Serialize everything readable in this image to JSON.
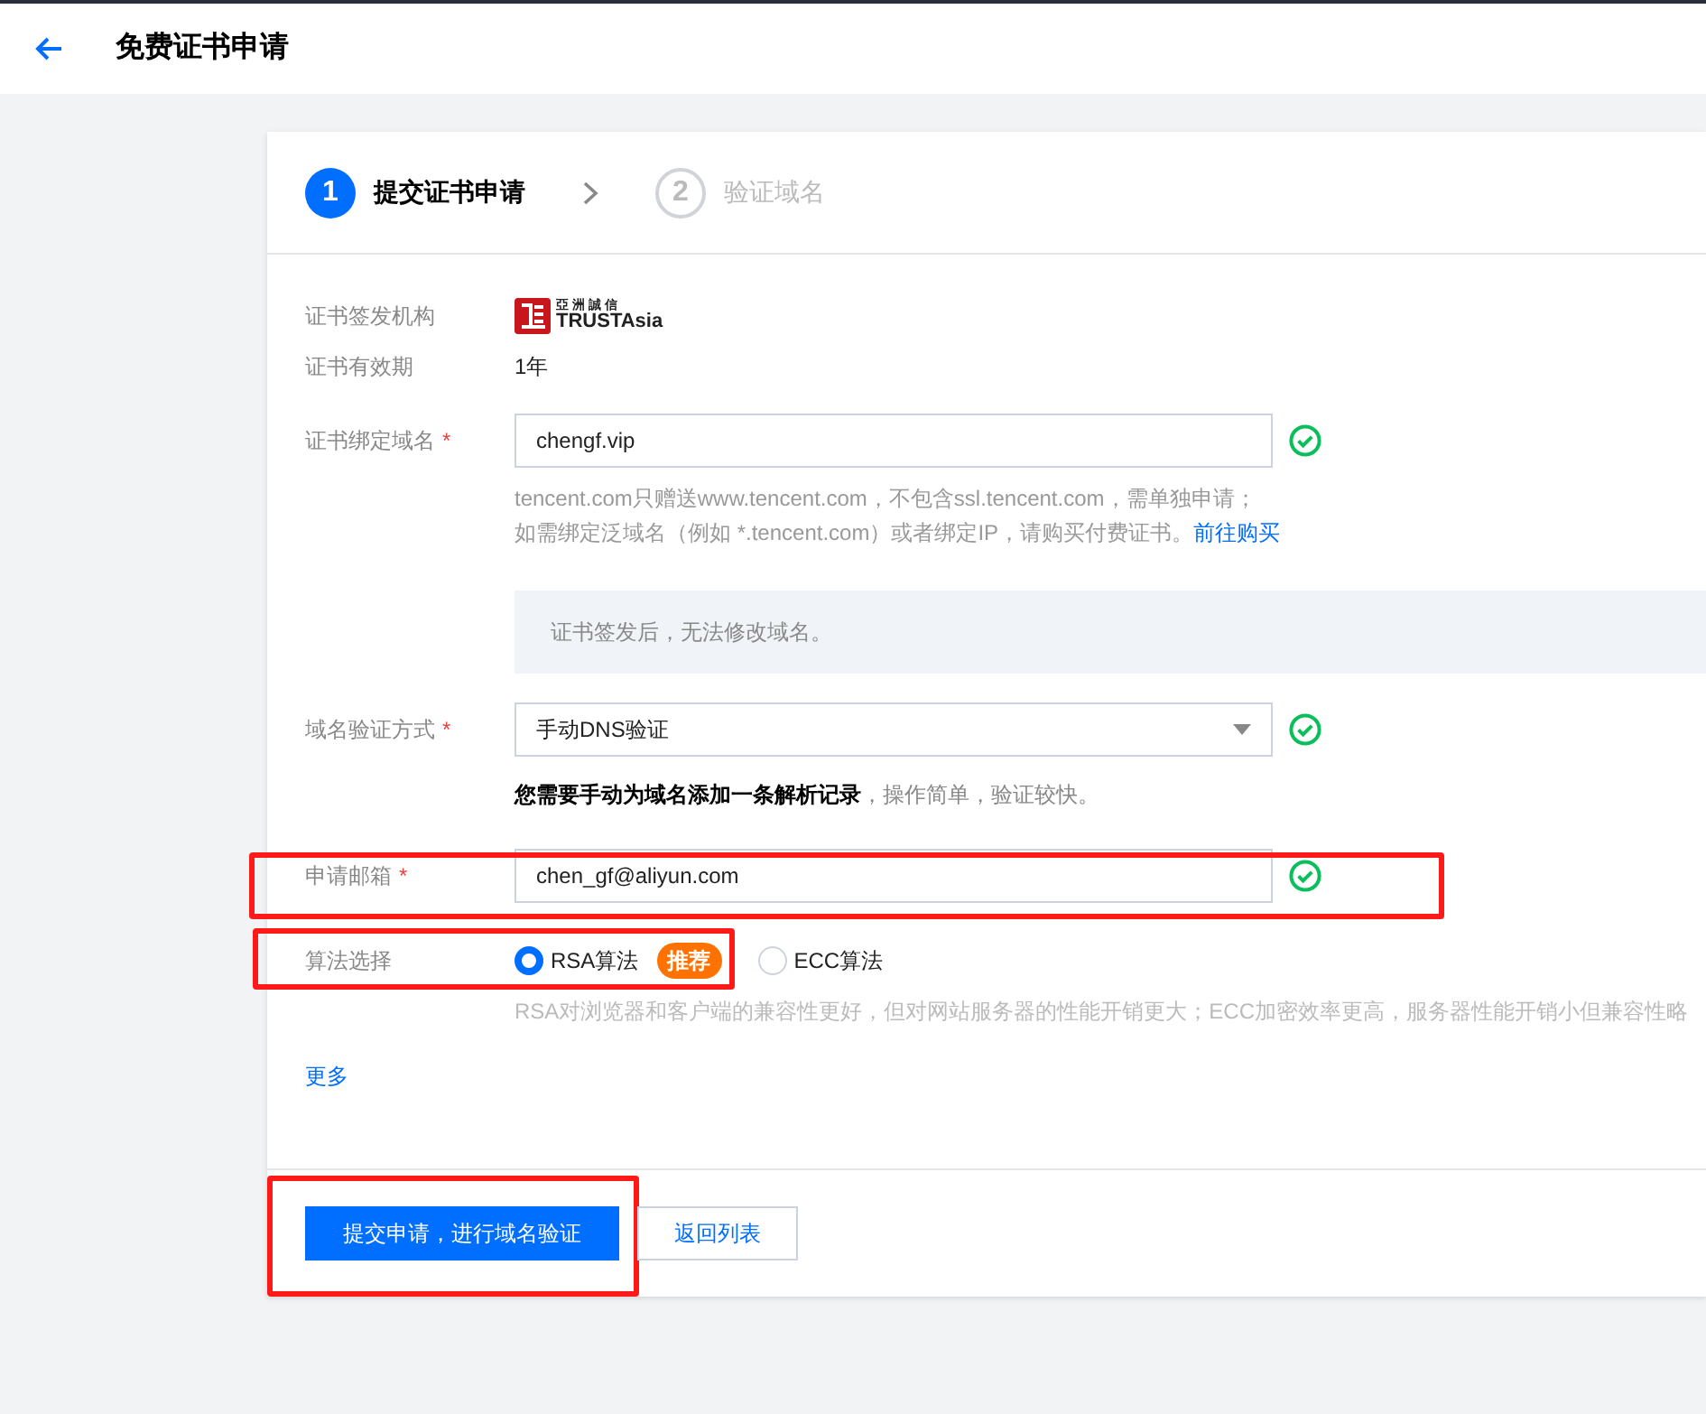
{
  "header": {
    "title": "免费证书申请"
  },
  "steps": [
    {
      "number": "1",
      "label": "提交证书申请",
      "selected": true
    },
    {
      "number": "2",
      "label": "验证域名",
      "selected": false
    }
  ],
  "form": {
    "rows": [
      {
        "kind": "logo",
        "label": "证书签发机构",
        "logo": {
          "name_cn": "亞洲誠信",
          "name_en": "TRUSTAsia"
        }
      },
      {
        "kind": "text",
        "label": "证书有效期",
        "value": "1年"
      },
      {
        "kind": "input",
        "label": "证书绑定域名",
        "required_mark": "*",
        "value": "chengf.vip",
        "valid": true,
        "highlighted": false,
        "hint_lines": [
          "tencent.com只赠送www.tencent.com，不包含ssl.tencent.com，需单独申请；",
          "如需绑定泛域名（例如 *.tencent.com）或者绑定IP，请购买付费证书。"
        ],
        "hint_link": "前往购买"
      },
      {
        "kind": "notice",
        "text": "证书签发后，无法修改域名。"
      },
      {
        "kind": "select",
        "label": "域名验证方式",
        "required_mark": "*",
        "value": "手动DNS验证",
        "valid": true,
        "highlighted": false,
        "note": "**您需要手动为域名添加一条解析记录**，操作简单，验证较快。"
      },
      {
        "kind": "input",
        "label": "申请邮箱",
        "required_mark": "*",
        "value": "chen_gf@aliyun.com",
        "valid": true,
        "highlighted": true
      },
      {
        "kind": "radio",
        "label": "算法选择",
        "highlighted": true,
        "options": [
          {
            "label": "RSA算法",
            "badge": "推荐",
            "selected": true
          },
          {
            "label": "ECC算法",
            "selected": false
          }
        ],
        "hint": "RSA对浏览器和客户端的兼容性更好，但对网站服务器的性能开销更大；ECC加密效率更高，服务器性能开销小但兼容性略"
      },
      {
        "kind": "link",
        "label": "更多"
      }
    ]
  },
  "buttons": [
    {
      "label": "提交申请，进行域名验证",
      "kind": "primary",
      "highlighted": true
    },
    {
      "label": "返回列表",
      "kind": "secondary",
      "highlighted": false
    }
  ]
}
